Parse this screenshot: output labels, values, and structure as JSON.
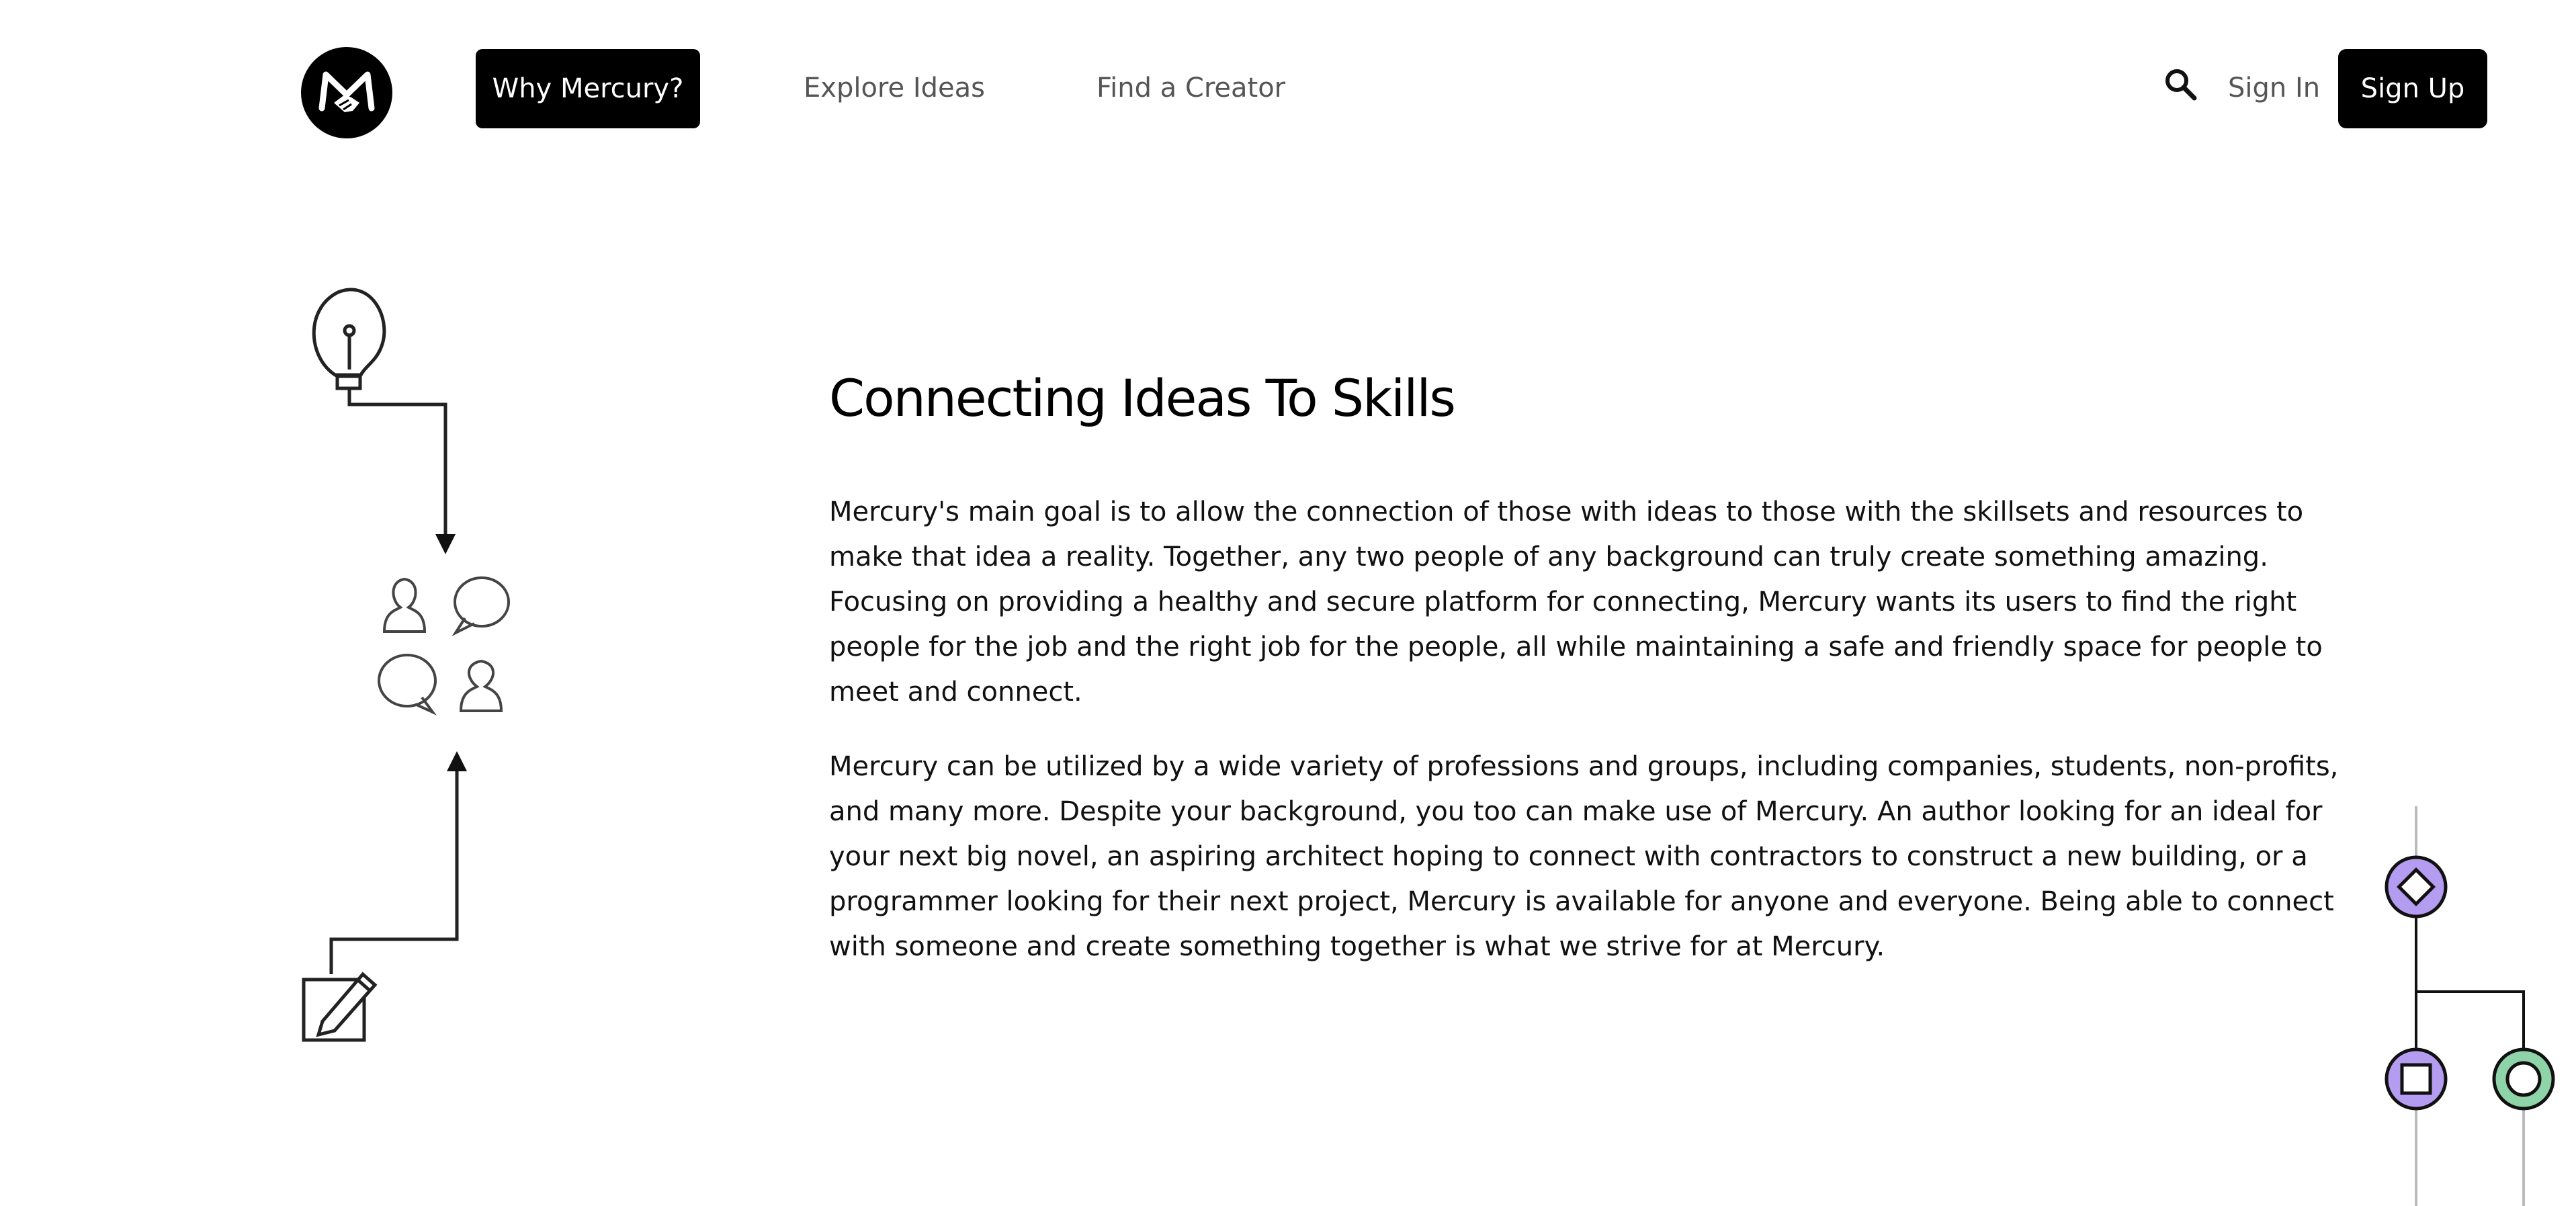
{
  "header": {
    "logo_icon": "handshake-m-logo",
    "nav": {
      "why_label": "Why Mercury?",
      "explore_label": "Explore Ideas",
      "creator_label": "Find a Creator"
    },
    "search_icon": "search-icon",
    "signin_label": "Sign In",
    "signup_label": "Sign Up"
  },
  "illustration": {
    "icons": [
      "lightbulb-icon",
      "arrow-down-icon",
      "person-icon",
      "speech-bubble-icon",
      "arrow-up-icon",
      "edit-pencil-icon"
    ]
  },
  "main": {
    "title": "Connecting Ideas To Skills",
    "paragraphs": [
      "Mercury's main goal is to allow the connection of those with ideas to those with the skillsets and resources to make that idea a reality. Together, any two people of any background can truly create something amazing. Focusing on providing a healthy and secure platform for connecting, Mercury wants its users to find the right people for the job and the right job for the people, all while maintaining a safe and friendly space for people to meet and connect.",
      "Mercury can be utilized by a wide variety of professions and groups, including companies, students, non-profits, and many more. Despite your background, you too can make use of Mercury. An author looking for an ideal for your next big novel, an aspiring architect hoping to connect with contractors to construct a new building, or a programmer looking for their next project, Mercury is available for anyone and everyone. Being able to connect with someone and create something together is what we strive for at Mercury."
    ]
  },
  "colors": {
    "primary": "#000000",
    "nav_text": "#555555",
    "node_purple": "#b49cf0",
    "node_green": "#8ed4a8"
  }
}
